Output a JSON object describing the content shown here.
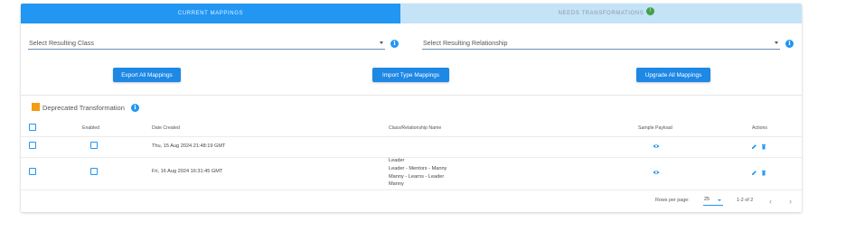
{
  "tabs": {
    "current": "CURRENT MAPPINGS",
    "needs": "NEEDS TRANSFORMATIONS",
    "needs_badge": "!"
  },
  "filters": {
    "class_placeholder": "Select Resulting Class",
    "relationship_placeholder": "Select Resulting Relationship"
  },
  "buttons": {
    "export": "Export All Mappings",
    "import": "Import Type Mappings",
    "upgrade": "Upgrade All Mappings"
  },
  "legend": {
    "label": "Deprecated Transformation",
    "color": "#f39c12"
  },
  "table": {
    "headers": {
      "enabled": "Enabled",
      "date": "Date Created",
      "name": "Class/Relationship Name",
      "payload": "Sample Payload",
      "actions": "Actions"
    },
    "rows": [
      {
        "date": "Thu, 15 Aug 2024 21:48:19 GMT",
        "name_lines": []
      },
      {
        "date": "Fri, 16 Aug 2024 16:31:45 GMT",
        "name_lines": [
          "Leader",
          "Leader - Mentors - Manny",
          "Manny - Learns - Leader",
          "Manny"
        ]
      }
    ]
  },
  "pagination": {
    "rows_per_page_label": "Rows per page:",
    "rows_per_page": "25",
    "range": "1-2 of 2"
  },
  "colors": {
    "accent": "#2196f3",
    "tab_inactive": "#c4e3f7",
    "badge": "#43a047"
  }
}
